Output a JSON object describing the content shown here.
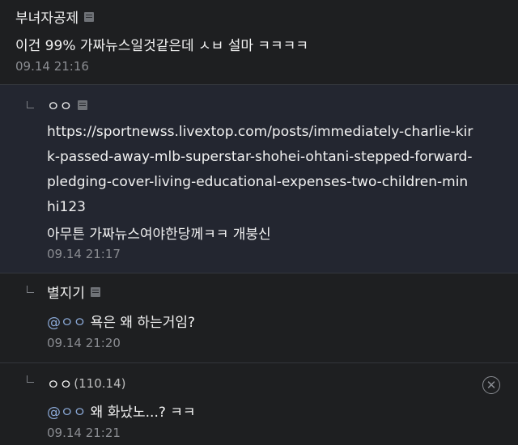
{
  "comments": [
    {
      "nick": "부녀자공제",
      "body": "이건 99% 가짜뉴스일것같은데 ㅅㅂ 설마 ㅋㅋㅋㅋ",
      "date": "09.14 21:16"
    },
    {
      "nick": "ㅇㅇ",
      "url_lines": [
        "https://sportnewss.livextop.com/posts/immediately-charlie-kir",
        "k-passed-away-mlb-superstar-shohei-ohtani-stepped-forward-",
        "pledging-cover-living-educational-expenses-two-children-min",
        "hi123"
      ],
      "body": "아무튼 가짜뉴스여야한당께ㅋㅋ 개붕신",
      "date": "09.14 21:17"
    },
    {
      "nick": "별지기",
      "mention": "@ㅇㅇ",
      "body": " 욕은 왜 하는거임?",
      "date": "09.14 21:20"
    },
    {
      "nick": "ㅇㅇ",
      "ip": "(110.14)",
      "mention": "@ㅇㅇ",
      "body": " 왜 화났노...? ㅋㅋ",
      "date": "09.14 21:21"
    }
  ],
  "colors": {
    "background": "#1e1f21",
    "highlight_background": "#232630",
    "mention": "#8aa8d6",
    "date": "#8b8d92"
  },
  "icons": [
    "writer-icon",
    "reply-arrow-icon",
    "delete-icon"
  ]
}
